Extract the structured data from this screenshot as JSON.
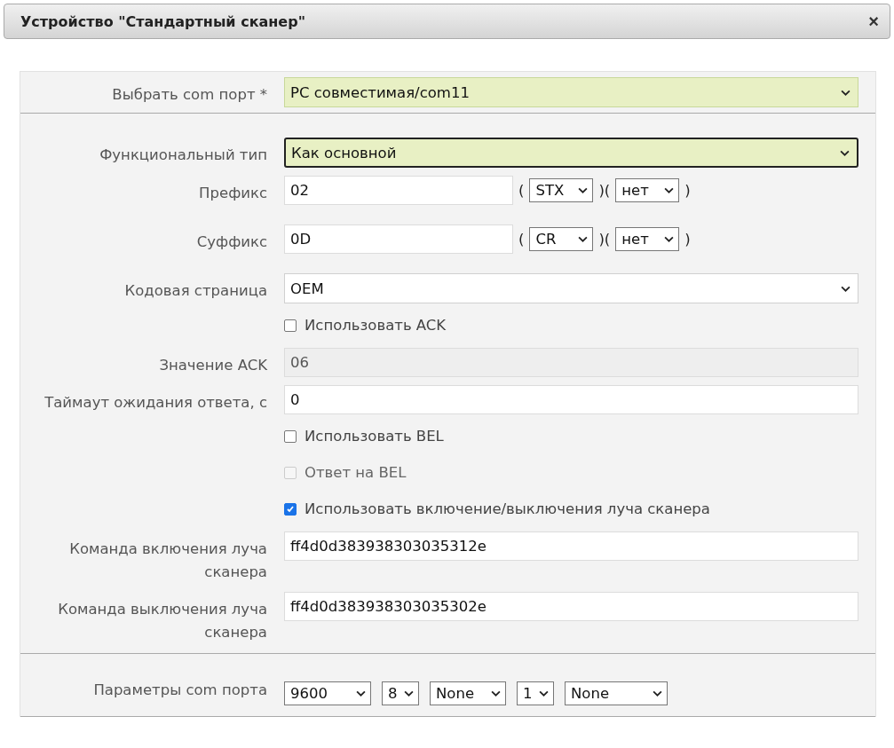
{
  "dialog": {
    "title": "Устройство \"Стандартный сканер\"",
    "close": "×"
  },
  "sections": [
    {
      "rows": [
        {
          "kind": "select",
          "label": "Выбрать com порт *",
          "value": "PC совместимая/com11",
          "highlighted": true,
          "focused": false
        }
      ]
    },
    {
      "rows": [
        {
          "kind": "select",
          "label": "Функциональный тип",
          "value": "Как основной",
          "highlighted": true,
          "focused": true
        },
        {
          "kind": "affix",
          "label": "Префикс",
          "value": "02",
          "open": "(",
          "mid": ")(",
          "close": ")",
          "selects": [
            "STX",
            "нет"
          ]
        },
        {
          "kind": "affix",
          "label": "Суффикс",
          "value": "0D",
          "open": "(",
          "mid": ")(",
          "close": ")",
          "selects": [
            "CR",
            "нет"
          ]
        },
        {
          "kind": "select",
          "label": "Кодовая страница",
          "value": "OEM",
          "highlighted": false,
          "focused": false
        },
        {
          "kind": "checkbox",
          "label": "Использовать ACK",
          "checked": false,
          "disabled": false
        },
        {
          "kind": "input",
          "label": "Значение ACK",
          "value": "06",
          "disabled": true
        },
        {
          "kind": "input",
          "label": "Таймаут ожидания ответа, с",
          "value": "0",
          "disabled": false
        },
        {
          "kind": "checkbox",
          "label": "Использовать BEL",
          "checked": false,
          "disabled": false
        },
        {
          "kind": "checkbox",
          "label": "Ответ на BEL",
          "checked": false,
          "disabled": true
        },
        {
          "kind": "checkbox",
          "label": "Использовать включение/выключения луча сканера",
          "checked": true,
          "disabled": false
        },
        {
          "kind": "input",
          "label": "Команда включения луча сканера",
          "value": "ff4d0d383938303035312e",
          "disabled": false
        },
        {
          "kind": "input",
          "label": "Команда выключения луча сканера",
          "value": "ff4d0d383938303035302e",
          "disabled": false
        }
      ]
    },
    {
      "rows": [
        {
          "kind": "selects",
          "label": "Параметры com порта",
          "selects": [
            "9600",
            "8",
            "None",
            "1",
            "None"
          ]
        }
      ]
    }
  ]
}
